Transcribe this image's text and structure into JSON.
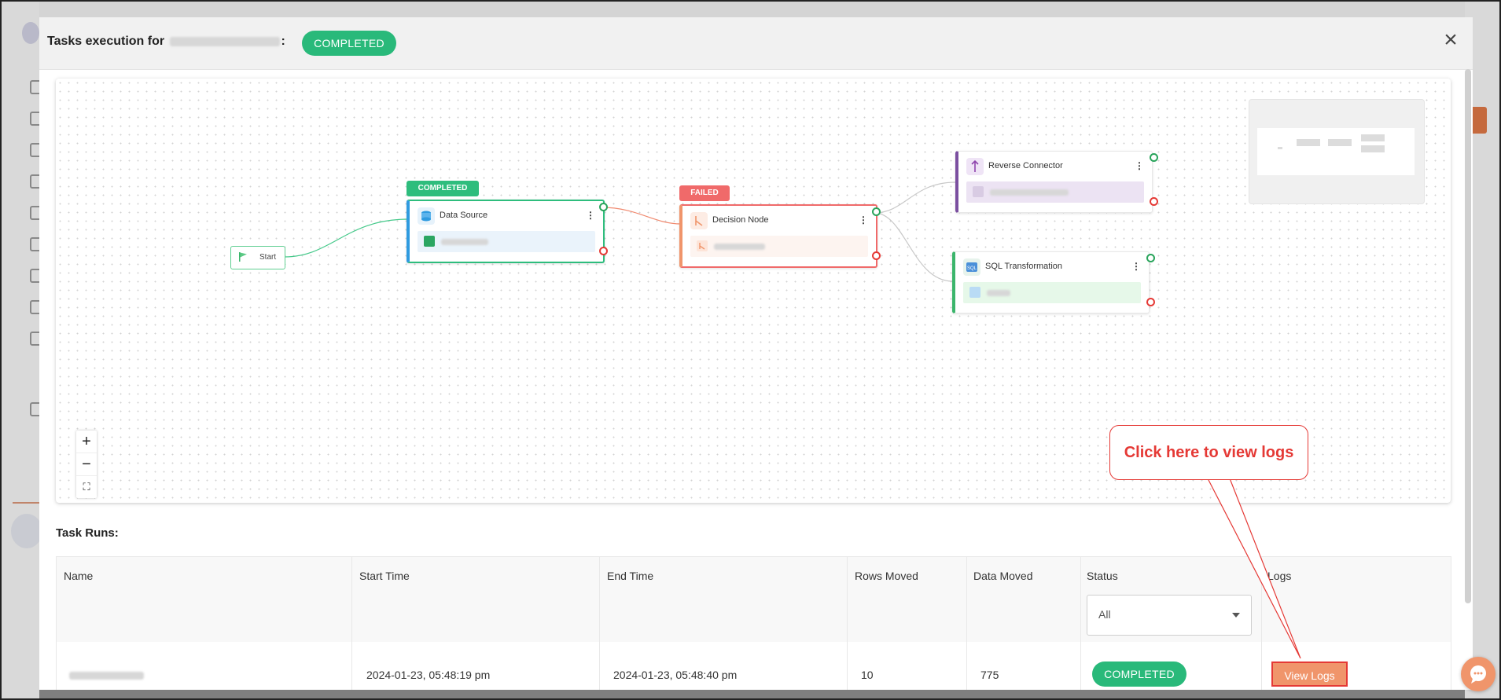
{
  "modal": {
    "title_prefix": "Tasks execution for",
    "title_suffix": ":",
    "status_badge": "COMPLETED",
    "close_icon": "×"
  },
  "flow": {
    "start_label": "Start",
    "nodes": [
      {
        "title": "Data Source",
        "status": "COMPLETED",
        "icon": "database-icon"
      },
      {
        "title": "Decision Node",
        "status": "FAILED",
        "icon": "decision-icon"
      },
      {
        "title": "Reverse Connector",
        "icon": "reverse-connector-icon"
      },
      {
        "title": "SQL Transformation",
        "icon": "sql-icon"
      }
    ],
    "zoom_in": "+",
    "zoom_out": "−",
    "fit_view": "⛶"
  },
  "task_runs": {
    "title": "Task Runs:",
    "columns": [
      "Name",
      "Start Time",
      "End Time",
      "Rows Moved",
      "Data Moved",
      "Status",
      "Logs"
    ],
    "status_filter": "All",
    "rows": [
      {
        "start_time": "2024-01-23, 05:48:19 pm",
        "end_time": "2024-01-23, 05:48:40 pm",
        "rows_moved": "10",
        "data_moved": "775",
        "status": "COMPLETED",
        "logs_button": "View Logs"
      }
    ]
  },
  "annotation": {
    "callout": "Click here to view logs"
  },
  "colors": {
    "completed": "#29b97a",
    "failed": "#f06a6a",
    "accent": "#f0956b",
    "callout": "#e53935"
  }
}
